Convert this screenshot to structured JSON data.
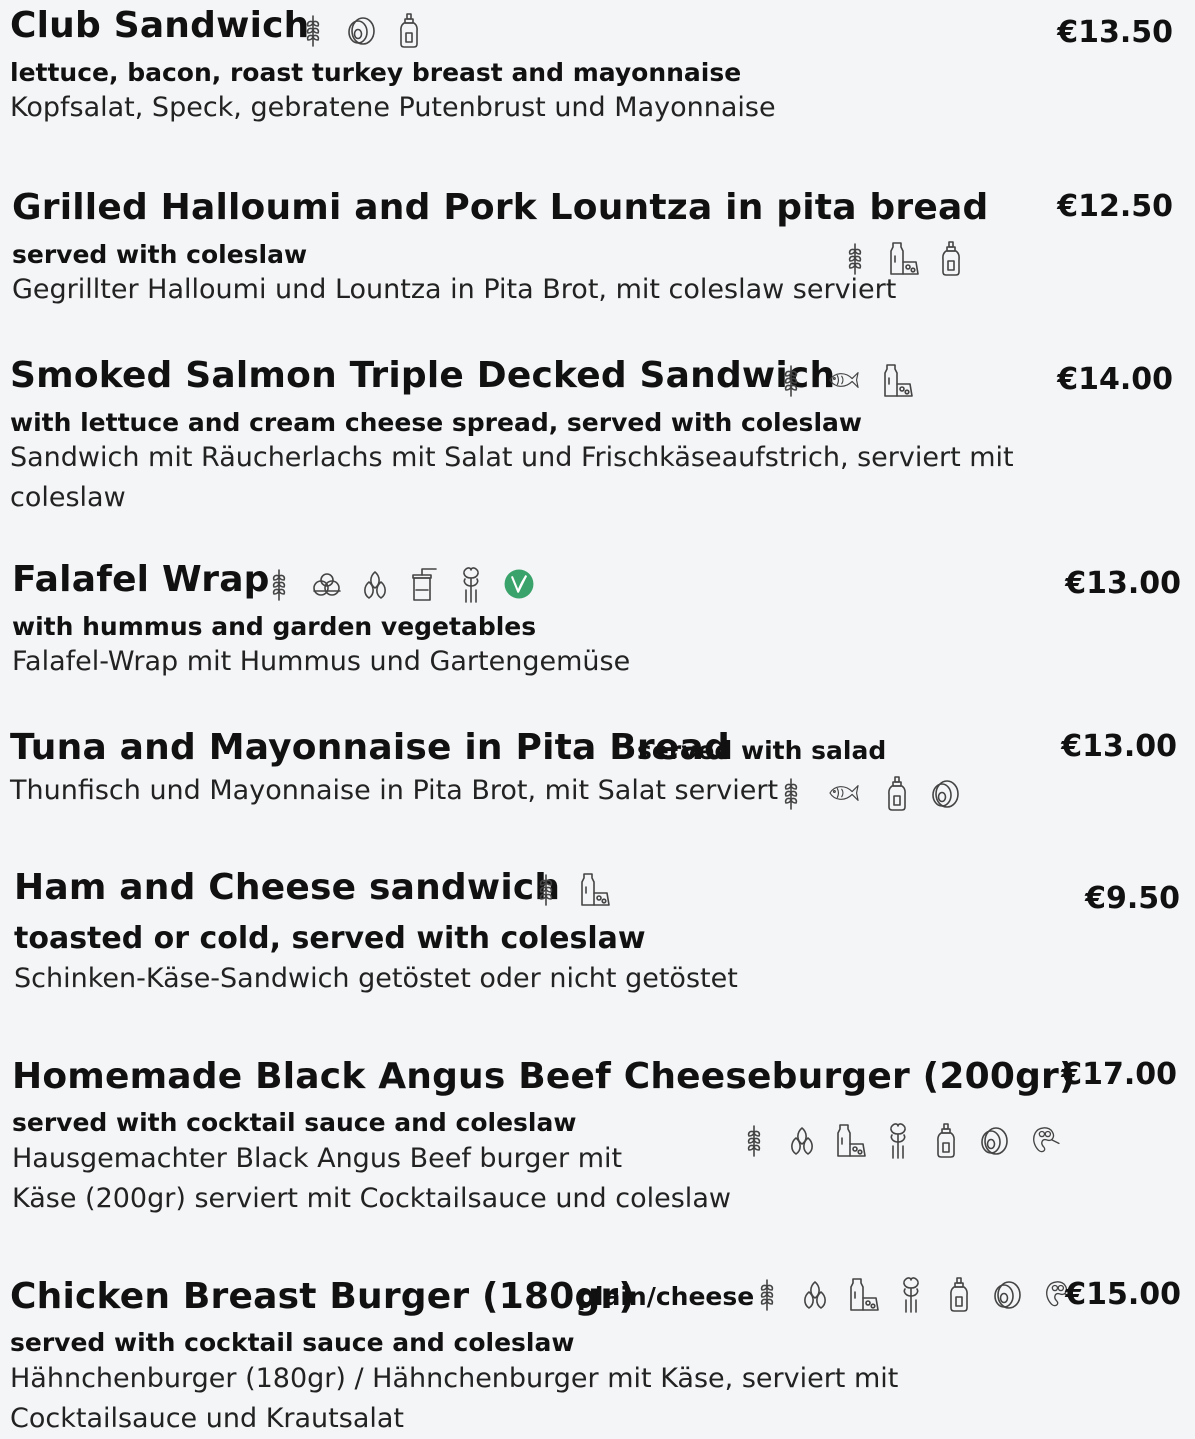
{
  "items": [
    {
      "title": "Club Sandwich",
      "price": "€13.50",
      "subtitle": "lettuce, bacon, roast turkey breast and mayonnaise",
      "description": [
        "Kopfsalat, Speck, gebratene Putenbrust und Mayonnaise"
      ],
      "icons": [
        "gluten-icon",
        "egg-icon",
        "mustard-icon"
      ]
    },
    {
      "title": "Grilled Halloumi and Pork Lountza in pita bread",
      "price": "€12.50",
      "subtitle": "served with coleslaw",
      "description": [
        "Gegrillter Halloumi und Lountza in Pita Brot, mit coleslaw serviert"
      ],
      "icons": [
        "gluten-icon",
        "milk-icon",
        "mustard-icon"
      ]
    },
    {
      "title": "Smoked Salmon Triple Decked Sandwich",
      "price": "€14.00",
      "subtitle": "with lettuce and cream cheese spread, served with coleslaw",
      "description": [
        "Sandwich mit Räucherlachs mit Salat und Frischkäseaufstrich, serviert mit",
        "coleslaw"
      ],
      "icons": [
        "gluten-icon",
        "fish-icon",
        "milk-icon"
      ]
    },
    {
      "title": "Falafel Wrap",
      "price": "€13.00",
      "subtitle": "with hummus and garden vegetables",
      "description": [
        "Falafel-Wrap mit Hummus und Gartengemüse"
      ],
      "icons": [
        "gluten-icon",
        "nuts-icon",
        "sesame-icon",
        "mustard-jar-icon",
        "celery-icon",
        "vegan-icon"
      ]
    },
    {
      "title": "Tuna and Mayonnaise in Pita Bread",
      "price": "€13.00",
      "subtitle": "served with salad",
      "description": [
        "Thunfisch und Mayonnaise in Pita Brot, mit Salat serviert"
      ],
      "icons": [
        "gluten-icon",
        "fish-icon",
        "mustard-icon",
        "egg-icon"
      ]
    },
    {
      "title": "Ham and Cheese sandwich",
      "price": "€9.50",
      "subtitle": "toasted or cold, served with coleslaw",
      "description": [
        "Schinken-Käse-Sandwich getöstet oder nicht getöstet"
      ],
      "icons": [
        "gluten-icon",
        "milk-icon"
      ]
    },
    {
      "title": "Homemade Black Angus Beef Cheeseburger (200gr)",
      "price": "€17.00",
      "subtitle": "served with cocktail sauce and coleslaw",
      "description": [
        "Hausgemachter Black Angus Beef burger mit",
        "Käse (200gr) serviert mit Cocktailsauce und coleslaw"
      ],
      "icons": [
        "gluten-icon",
        "sesame-icon",
        "milk-icon",
        "celery-icon",
        "mustard-icon",
        "egg-icon",
        "soy-icon"
      ]
    },
    {
      "title": "Chicken Breast Burger (180gr)",
      "price": "€15.00",
      "tag": "plain/cheese",
      "subtitle": "served with cocktail sauce and coleslaw",
      "description": [
        "Hähnchenburger (180gr) / Hähnchenburger mit Käse, serviert mit",
        "Cocktailsauce und Krautsalat"
      ],
      "icons": [
        "gluten-icon",
        "sesame-icon",
        "milk-icon",
        "celery-icon",
        "mustard-icon",
        "egg-icon",
        "soy-icon"
      ]
    }
  ]
}
